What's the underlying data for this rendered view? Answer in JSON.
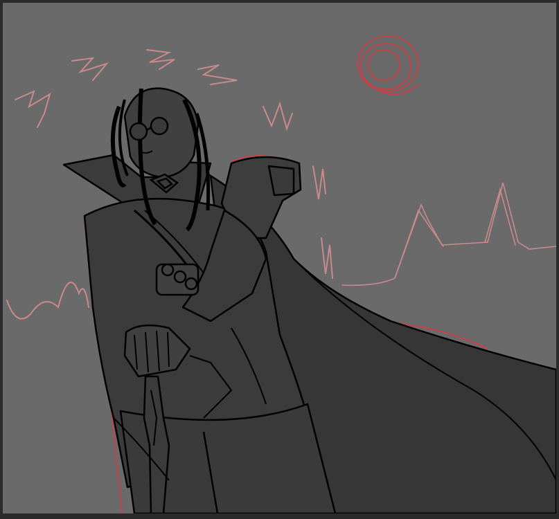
{
  "artwork": {
    "icons": {
      "sun": "sun-sketch-icon"
    },
    "colors": {
      "frame": "#2b2b2b",
      "canvas": "#6a6a6a",
      "figure_fill": "#3b3b3b",
      "cape_fill": "#363636",
      "lineart": "#000000",
      "sketch_red": "#c2454a",
      "sketch_pink": "#c98a8c"
    }
  }
}
